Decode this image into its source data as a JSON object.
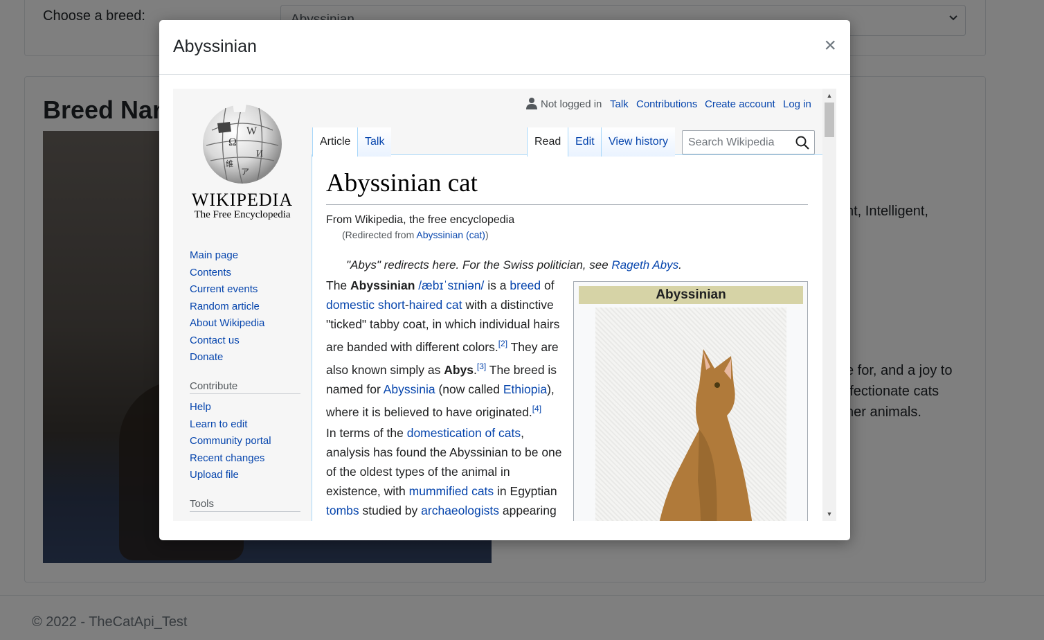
{
  "background": {
    "breed_select_label": "Choose a breed:",
    "breed_select_value": "Abyssinian",
    "breed_name_heading": "Breed Name",
    "temperament_fragment": "nt, Intelligent,",
    "description_fragments": [
      "e for, and a joy to",
      "ffectionate cats",
      "her animals."
    ],
    "footer_text": "© 2022 - TheCatApi_Test"
  },
  "modal": {
    "title": "Abyssinian",
    "close_label": "×"
  },
  "wikipedia": {
    "logo_wordmark": "WIKIPEDIA",
    "logo_tagline": "The Free Encyclopedia",
    "nav_main": [
      "Main page",
      "Contents",
      "Current events",
      "Random article",
      "About Wikipedia",
      "Contact us",
      "Donate"
    ],
    "contribute_heading": "Contribute",
    "nav_contribute": [
      "Help",
      "Learn to edit",
      "Community portal",
      "Recent changes",
      "Upload file"
    ],
    "tools_heading": "Tools",
    "personal": {
      "not_logged_in": "Not logged in",
      "talk": "Talk",
      "contributions": "Contributions",
      "create_account": "Create account",
      "log_in": "Log in"
    },
    "tabs_left": [
      "Article",
      "Talk"
    ],
    "tabs_right": [
      "Read",
      "Edit",
      "View history"
    ],
    "search_placeholder": "Search Wikipedia",
    "heading": "Abyssinian cat",
    "site_sub": "From Wikipedia, the free encyclopedia",
    "redirect_prefix": "(Redirected from ",
    "redirect_link": "Abyssinian (cat)",
    "redirect_suffix": ")",
    "hatnote_text": "\"Abys\" redirects here. For the Swiss politician, see ",
    "hatnote_link": "Rageth Abys",
    "hatnote_end": ".",
    "p1": {
      "t1": "The ",
      "b1": "Abyssinian",
      "ipa": "/æbɪˈsɪniən/",
      "t2": " is a ",
      "l_breed": "breed",
      "t3": " of ",
      "l_domestic": "domestic",
      "t4": " ",
      "l_short": "short",
      "t5": "-",
      "l_haired": "haired cat",
      "t6": " with a distinctive \"ticked\" tabby coat, in which individual hairs are banded with different colors.",
      "ref2": "[2]",
      "t7": " They are also known simply as ",
      "b2": "Abys",
      "t8": ".",
      "ref3": "[3]",
      "t9": " The breed is named for ",
      "l_abyssinia": "Abyssinia",
      "t10": " (now called ",
      "l_ethiopia": "Ethiopia",
      "t11": "), where it is believed to have originated.",
      "ref4": "[4]"
    },
    "p2": {
      "t1": "In terms of the ",
      "l_domestication": "domestication of cats",
      "t2": ", analysis has found the Abyssinian to be one of the oldest types of the animal in existence, with ",
      "l_mummified": "mummified cats",
      "t3": " in Egyptian ",
      "l_tombs": "tombs",
      "t4": " studied by ",
      "l_archaeologists": "archaeologists",
      "t5": " appearing"
    },
    "infobox_title": "Abyssinian"
  },
  "colors": {
    "link": "#0645ad",
    "infobox_header": "#d6d3a6",
    "backdrop": "rgba(0,0,0,0.5)"
  }
}
